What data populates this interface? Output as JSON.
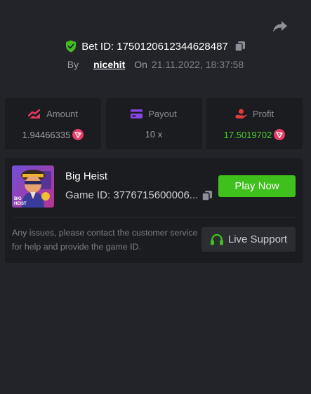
{
  "icons": {
    "share": "share-icon",
    "verified": "verified-shield-icon",
    "copy": "copy-icon",
    "amount": "amount-icon",
    "payout": "payout-icon",
    "profit": "profit-icon",
    "coin": "trx-coin-icon",
    "support": "headset-icon"
  },
  "colors": {
    "background": "#232429",
    "card": "#1b1c20",
    "accent_green": "#3fc01d",
    "profit_green": "#4ecb2b",
    "amount_icon": "#e8375a",
    "payout_icon": "#8a45e6",
    "profit_icon": "#e23b3b",
    "coin_red": "#ea3b67"
  },
  "bet": {
    "id_text": "Bet ID: 1750120612344628487",
    "by_label": "By",
    "username": "nicehit",
    "on_label": "On",
    "datetime": "21.11.2022, 18:37:58"
  },
  "stats": {
    "amount": {
      "label": "Amount",
      "value": "1.94466335"
    },
    "payout": {
      "label": "Payout",
      "value": "10 x"
    },
    "profit": {
      "label": "Profit",
      "value": "17.5019702"
    }
  },
  "game": {
    "title": "Big Heist",
    "id_text": "Game ID: 3776715600006...",
    "thumbnail_text": "BIG HEIST",
    "play_label": "Play Now",
    "issues_text": "Any issues, please contact the customer service for help and provide the game ID.",
    "support_label": "Live Support"
  }
}
